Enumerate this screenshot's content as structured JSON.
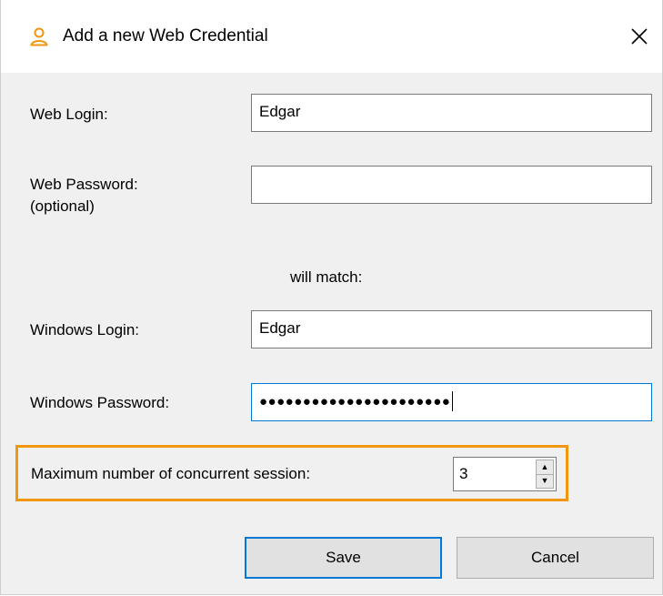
{
  "dialog": {
    "title": "Add a new Web Credential",
    "accent_color": "#f0960f"
  },
  "fields": {
    "web_login_label": "Web Login:",
    "web_login_value": "Edgar",
    "web_password_label": "Web Password:",
    "web_password_note": "(optional)",
    "web_password_value": "",
    "match_text": "will match:",
    "windows_login_label": "Windows Login:",
    "windows_login_value": "Edgar",
    "windows_password_label": "Windows Password:",
    "windows_password_masked": "●●●●●●●●●●●●●●●●●●●●●●"
  },
  "sessions": {
    "label": "Maximum number of concurrent session:",
    "value": "3"
  },
  "buttons": {
    "save": "Save",
    "cancel": "Cancel"
  },
  "icons": {
    "title": "user-icon",
    "close": "close-icon",
    "up": "spin-up-icon",
    "down": "spin-down-icon"
  }
}
